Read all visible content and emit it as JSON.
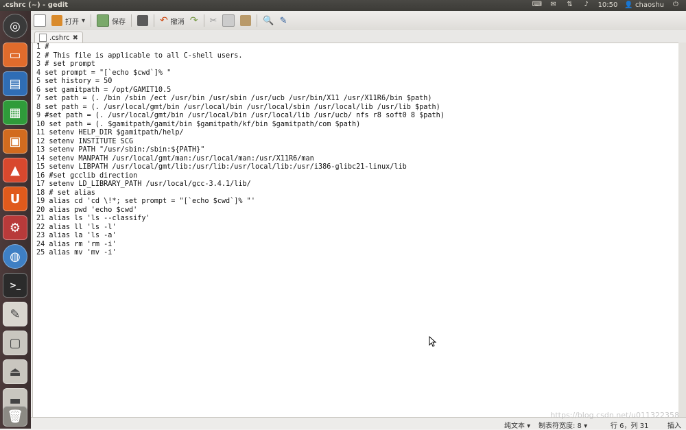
{
  "window": {
    "title": ".cshrc (~) - gedit"
  },
  "tray": {
    "time": "10:50",
    "user": "chaoshu"
  },
  "toolbar": {
    "open_label": "打开",
    "save_label": "保存",
    "undo_label": "撤消"
  },
  "tab": {
    "label": ".cshrc"
  },
  "lines": [
    "#",
    "# This file is applicable to all C-shell users.",
    "# set prompt",
    "set prompt = \"[`echo $cwd`]% \"",
    "set history = 50",
    "set gamitpath = /opt/GAMIT10.5",
    "set path = (. /bin /sbin /ect /usr/bin /usr/sbin /usr/ucb /usr/bin/X11 /usr/X11R6/bin $path)",
    "set path = (. /usr/local/gmt/bin /usr/local/bin /usr/local/sbin /usr/local/lib /usr/lib $path)",
    "#set path = (. /usr/local/gmt/bin /usr/local/bin /usr/local/lib /usr/ucb/ nfs r8 soft0 8 $path)",
    "set path = (. $gamitpath/gamit/bin $gamitpath/kf/bin $gamitpath/com $path)",
    "setenv HELP_DIR $gamitpath/help/",
    "setenv INSTITUTE SCG",
    "setenv PATH \"/usr/sbin:/sbin:${PATH}\"",
    "setenv MANPATH /usr/local/gmt/man:/usr/local/man:/usr/X11R6/man",
    "setenv LIBPATH /usr/local/gmt/lib:/usr/lib:/usr/local/lib:/usr/i386-glibc21-linux/lib",
    "#set gcclib direction",
    "setenv LD_LIBRARY_PATH /usr/local/gcc-3.4.1/lib/",
    "# set alias",
    "alias cd 'cd \\!*; set prompt = \"[`echo $cwd`]% \"'",
    "alias pwd 'echo $cwd'",
    "alias ls 'ls --classify'",
    "alias ll 'ls -l'",
    "alias la 'ls -a'",
    "alias rm 'rm -i'",
    "alias mv 'mv -i'"
  ],
  "status": {
    "language": "纯文本 ▾",
    "tab_width": "制表符宽度: 8 ▾",
    "position": "行 6，列 31",
    "mode": "插入"
  },
  "watermark": "https://blog.csdn.net/u011322358",
  "colors": {
    "launcher_bg": "#3b2f2f",
    "editor_bg": "#ffffff",
    "topbar_bg": "#3c3b37"
  }
}
